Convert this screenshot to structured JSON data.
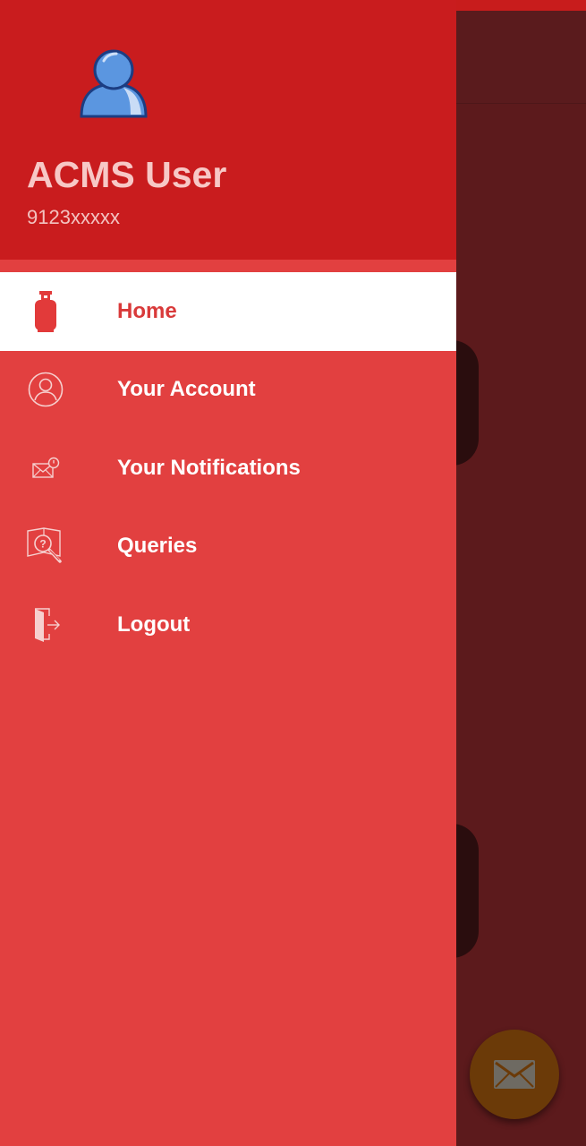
{
  "user": {
    "name": "ACMS User",
    "phone": "9123xxxxx"
  },
  "menu": {
    "items": [
      {
        "label": "Home",
        "icon": "gas-cylinder-icon",
        "active": true
      },
      {
        "label": "Your Account",
        "icon": "user-circle-icon",
        "active": false
      },
      {
        "label": "Your Notifications",
        "icon": "mail-notification-icon",
        "active": false
      },
      {
        "label": "Queries",
        "icon": "search-question-icon",
        "active": false
      },
      {
        "label": "Logout",
        "icon": "logout-door-icon",
        "active": false
      }
    ]
  },
  "fab": {
    "icon": "envelope-icon"
  },
  "colors": {
    "header": "#c91c1e",
    "drawer": "#e24040",
    "active_text": "#d93a3a",
    "scrim": "#5a1a1c",
    "fab": "#6b3a08"
  }
}
